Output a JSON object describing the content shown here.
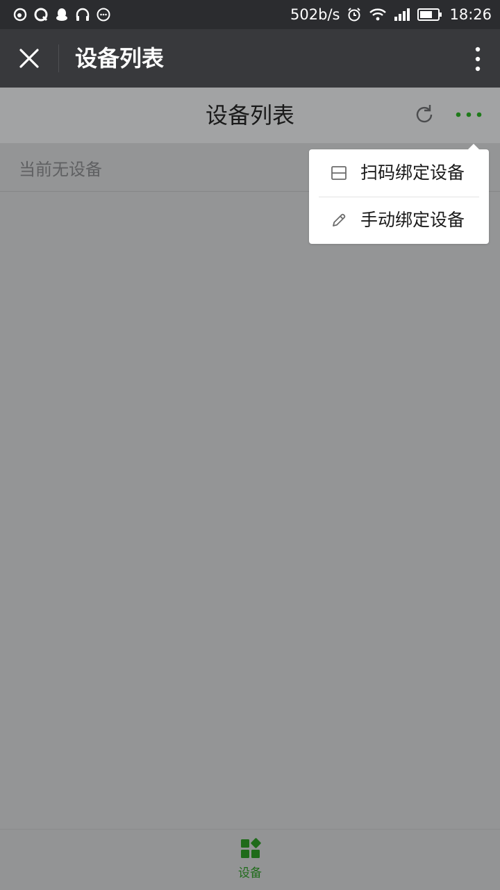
{
  "status_bar": {
    "network_speed": "502b/s",
    "time": "18:26",
    "icons": [
      "weibo-icon",
      "qq-browser-icon",
      "qq-icon",
      "headphones-icon",
      "chat-icon",
      "alarm-icon",
      "wifi-icon",
      "signal-icon",
      "battery-icon"
    ]
  },
  "titlebar": {
    "title": "设备列表",
    "close_icon": "close-icon",
    "more_icon": "vertical-more-icon"
  },
  "page": {
    "title": "设备列表",
    "refresh_icon": "refresh-icon",
    "more_icon": "more-dots-icon",
    "empty_text": "当前无设备"
  },
  "menu": {
    "items": [
      {
        "label": "扫码绑定设备",
        "icon": "scan-icon"
      },
      {
        "label": "手动绑定设备",
        "icon": "pencil-icon"
      }
    ]
  },
  "tabbar": {
    "tabs": [
      {
        "label": "设备",
        "icon": "devices-icon",
        "active": true
      }
    ]
  },
  "colors": {
    "accent_green": "#1f7a1a",
    "status_bar_bg": "#2b2c2f",
    "titlebar_bg": "#38393c",
    "overlay_bg": "#949596"
  }
}
